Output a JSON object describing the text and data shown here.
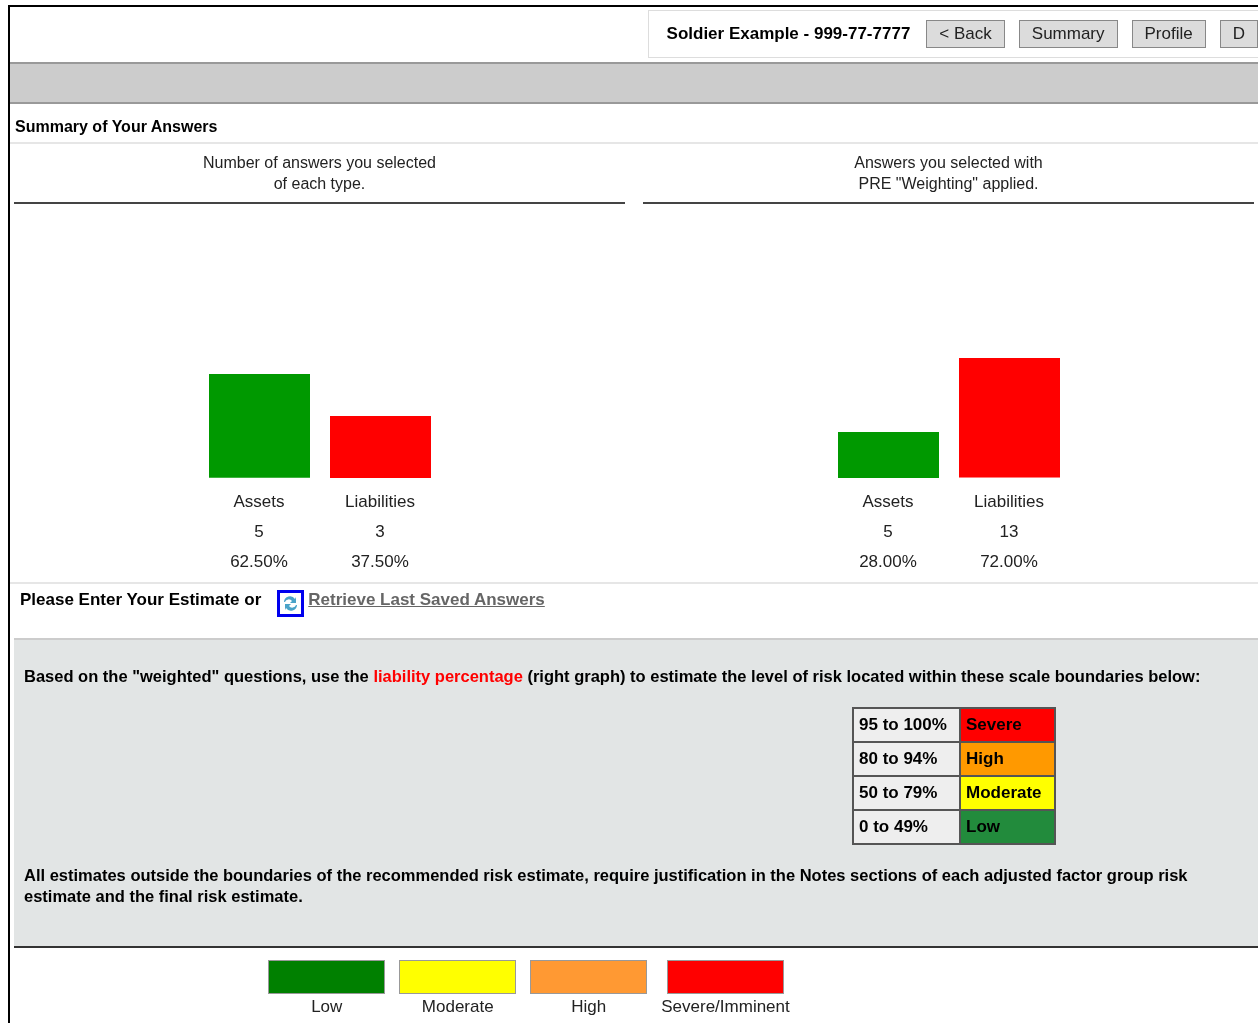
{
  "header": {
    "title": "Soldier Example - 999-77-7777",
    "buttons": [
      "< Back",
      "Summary",
      "Profile",
      "D"
    ]
  },
  "summary": {
    "title": "Summary of Your Answers",
    "charts": [
      {
        "caption_lines": [
          "Number of answers you selected",
          "of each type."
        ],
        "bars": [
          {
            "count": "5",
            "color": "#009900"
          },
          {
            "count": "3",
            "color": "#ff0000"
          }
        ],
        "chart_data": {
          "type": "bar",
          "categories": [
            "Assets",
            "Liabilities"
          ],
          "values": [
            62.5,
            37.5
          ],
          "data_labels": "value_labels",
          "value_labels": [
            "62.50%",
            "37.50%"
          ]
        }
      },
      {
        "caption_lines": [
          "Answers you selected with",
          "PRE \"Weighting\" applied."
        ],
        "bars": [
          {
            "count": "5",
            "color": "#009900"
          },
          {
            "count": "13",
            "color": "#ff0000"
          }
        ],
        "chart_data": {
          "type": "bar",
          "categories": [
            "Assets",
            "Liabilities"
          ],
          "values": [
            28,
            72
          ],
          "data_labels": "value_labels",
          "value_labels": [
            "28.00%",
            "72.00%"
          ]
        }
      }
    ]
  },
  "estimate": {
    "label": "Please Enter Your Estimate or",
    "link": "Retrieve Last Saved Answers"
  },
  "instructions": {
    "text": "Based on the \"weighted\" questions, use the **liability percentage** (right graph)  to estimate the level of risk located within these scale boundaries below:",
    "scale": [
      {
        "range": "95 to 100%",
        "level": "Severe",
        "color": "#ff0000"
      },
      {
        "range": "80 to 94%",
        "level": "High",
        "color": "#ff9900"
      },
      {
        "range": "50 to 79%",
        "level": "Moderate",
        "color": "#ffff00"
      },
      {
        "range": "0 to 49%",
        "level": "Low",
        "color": "#228b3c"
      }
    ],
    "note": "All estimates outside the boundaries of the recommended risk estimate, require justification in the Notes sections of each adjusted factor group risk estimate and the final risk estimate."
  },
  "legend": [
    {
      "label": "Low",
      "color": "#008000"
    },
    {
      "label": "Moderate",
      "color": "#ffff00"
    },
    {
      "label": "High",
      "color": "#ff9933"
    },
    {
      "label": "Severe/Imminent",
      "color": "#ff0000"
    }
  ]
}
